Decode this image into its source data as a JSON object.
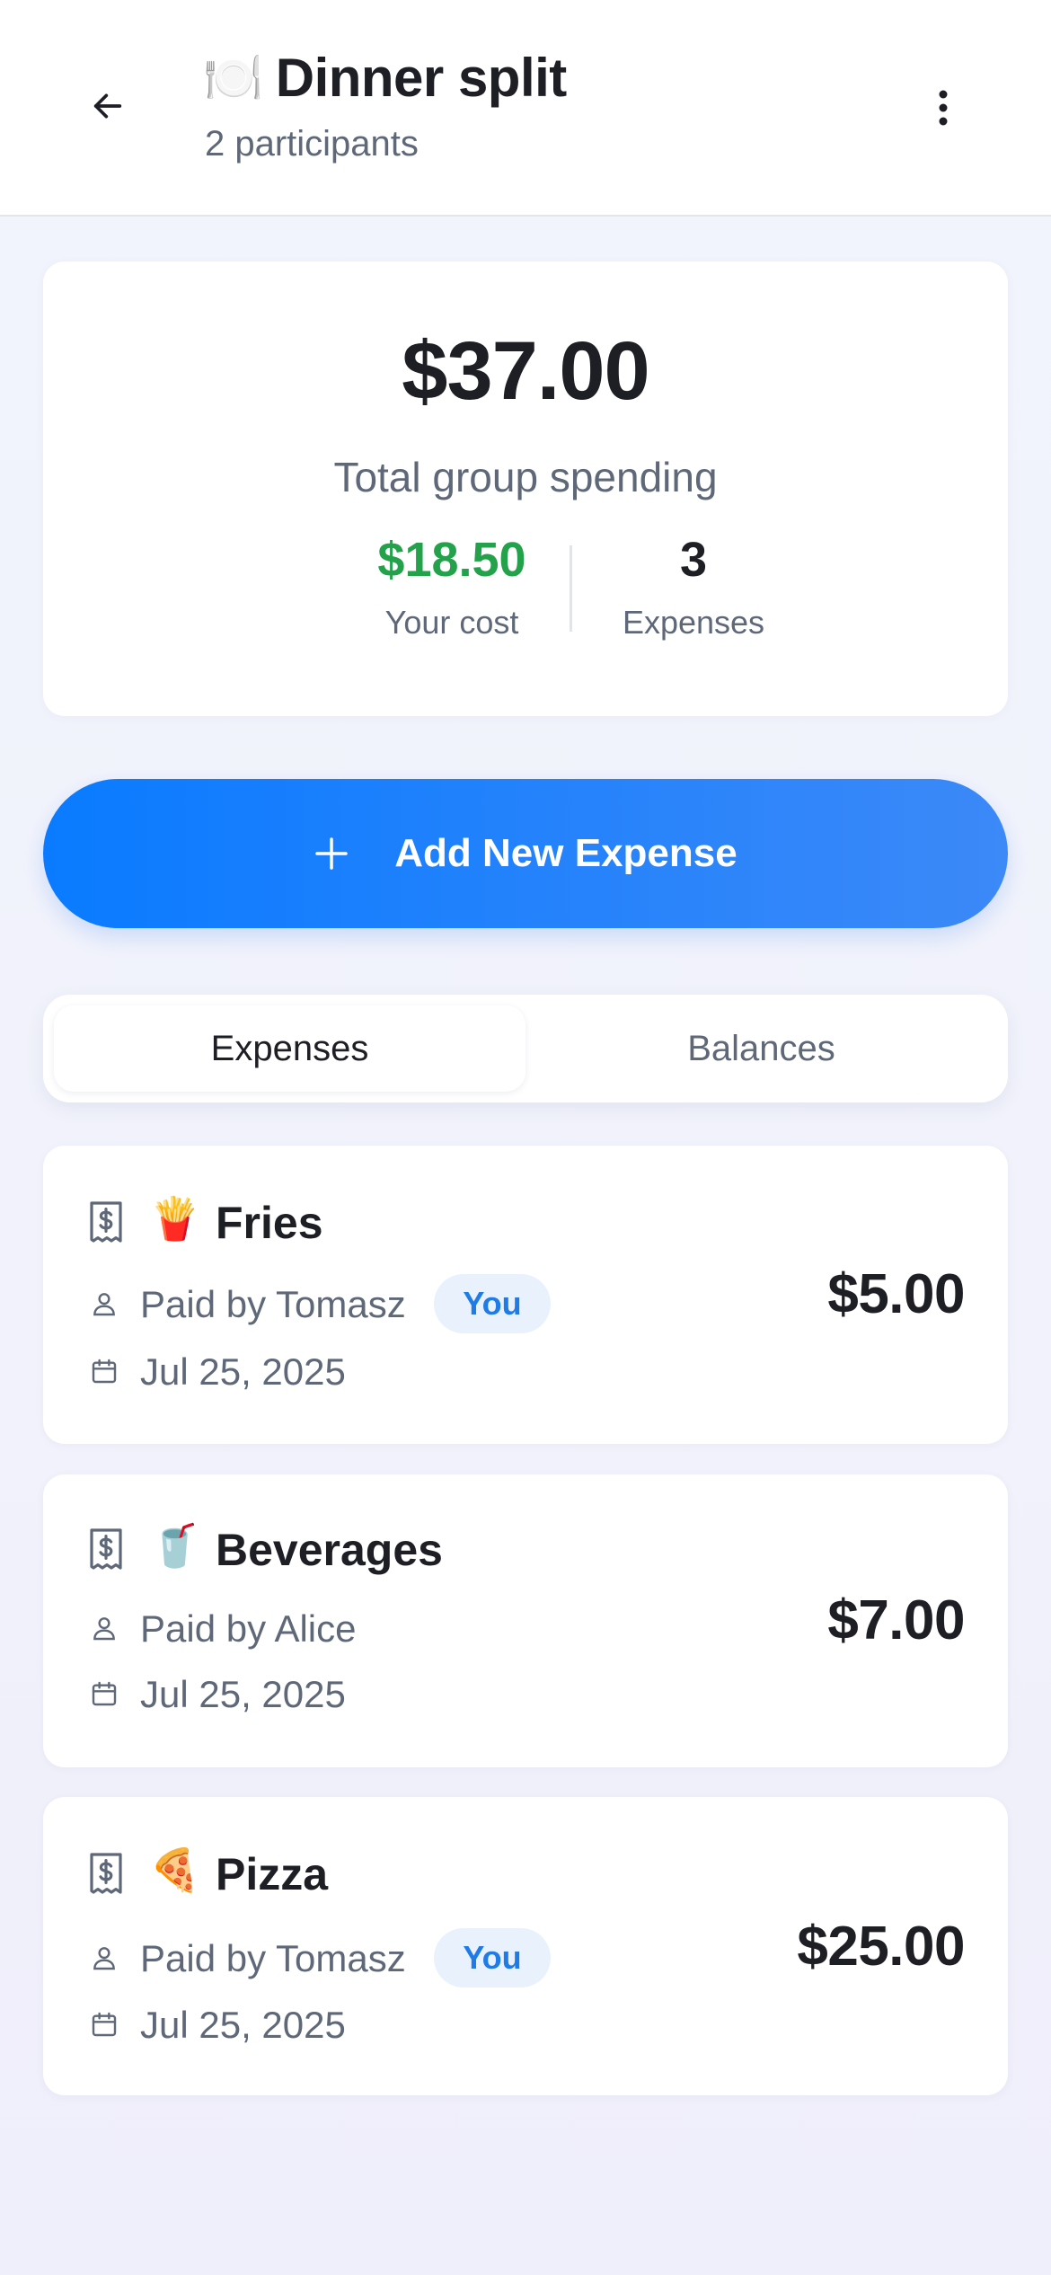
{
  "header": {
    "title_emoji": "🍽️",
    "title": "Dinner split",
    "subtitle": "2 participants"
  },
  "summary": {
    "total_amount": "$37.00",
    "total_label": "Total group spending",
    "your_cost_value": "$18.50",
    "your_cost_label": "Your cost",
    "expenses_count": "3",
    "expenses_label": "Expenses"
  },
  "add_button": {
    "label": "Add New Expense"
  },
  "tabs": [
    {
      "label": "Expenses",
      "active": true
    },
    {
      "label": "Balances",
      "active": false
    }
  ],
  "expenses": [
    {
      "emoji": "🍟",
      "name": "Fries",
      "paid_by": "Paid by Tomasz",
      "badge": "You",
      "date": "Jul 25, 2025",
      "amount": "$5.00"
    },
    {
      "emoji": "🥤",
      "name": "Beverages",
      "paid_by": "Paid by Alice",
      "badge": "",
      "date": "Jul 25, 2025",
      "amount": "$7.00"
    },
    {
      "emoji": "🍕",
      "name": "Pizza",
      "paid_by": "Paid by Tomasz",
      "badge": "You",
      "date": "Jul 25, 2025",
      "amount": "$25.00"
    }
  ],
  "colors": {
    "accent_blue": "#0a7bff",
    "cost_green": "#23a24b",
    "badge_bg": "#e9f1fd",
    "badge_text": "#1f7be6"
  },
  "icons": {
    "back": "arrow-left-icon",
    "menu": "more-vertical-icon",
    "add": "plus-icon",
    "receipt": "receipt-dollar-icon",
    "user": "user-icon",
    "calendar": "calendar-icon"
  }
}
